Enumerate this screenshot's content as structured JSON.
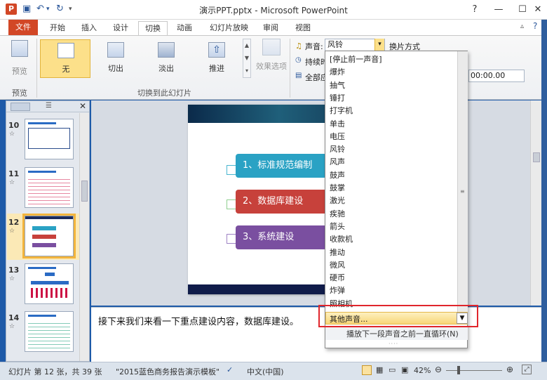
{
  "window": {
    "title": "演示PPT.pptx - Microsoft PowerPoint"
  },
  "tabs": {
    "file": "文件",
    "items": [
      "开始",
      "插入",
      "设计",
      "切换",
      "动画",
      "幻灯片放映",
      "审阅",
      "视图"
    ],
    "active": "切换"
  },
  "ribbon": {
    "preview_label": "预览",
    "preview_group": "预览",
    "transitions": [
      {
        "label": "无"
      },
      {
        "label": "切出"
      },
      {
        "label": "淡出"
      },
      {
        "label": "推进"
      }
    ],
    "effect_options": "效果选项",
    "transition_group": "切换到此幻灯片",
    "sound_label": "声音:",
    "sound_value": "风铃",
    "duration_label": "持续时",
    "apply_all_label": "全部应",
    "advance_label": "换片方式",
    "time_value": "00:00.00"
  },
  "slides_pane": {
    "slides": [
      {
        "num": "10",
        "mark": "☆"
      },
      {
        "num": "11",
        "mark": "☆"
      },
      {
        "num": "12",
        "mark": "☆"
      },
      {
        "num": "13",
        "mark": "☆"
      },
      {
        "num": "14",
        "mark": "☆"
      }
    ]
  },
  "slide": {
    "items": [
      {
        "text": "1、标准规范编制",
        "color": "#2aa2c4"
      },
      {
        "text": "2、数据库建设",
        "color": "#c7413b"
      },
      {
        "text": "3、系统建设",
        "color": "#7a4fa0"
      }
    ]
  },
  "notes": {
    "text": "接下来我们来看一下重点建设内容，数据库建设。"
  },
  "sound_dropdown": {
    "items": [
      "[停止前一声音]",
      "爆炸",
      "抽气",
      "锤打",
      "打字机",
      "单击",
      "电压",
      "风铃",
      "风声",
      "鼓声",
      "鼓掌",
      "激光",
      "疾驰",
      "箭头",
      "收款机",
      "推动",
      "微风",
      "硬币",
      "炸弹",
      "照相机"
    ],
    "other_sound": "其他声音...",
    "loop_option": "播放下一段声音之前一直循环(N)"
  },
  "statusbar": {
    "slide_info": "幻灯片 第 12 张，共 39 张",
    "theme": "\"2015蓝色商务报告演示模板\"",
    "language": "中文(中国)",
    "zoom": "42%"
  },
  "colors": {
    "file_tab": "#d24726",
    "selection": "#f2b43c",
    "highlight_box": "#e0262c"
  }
}
